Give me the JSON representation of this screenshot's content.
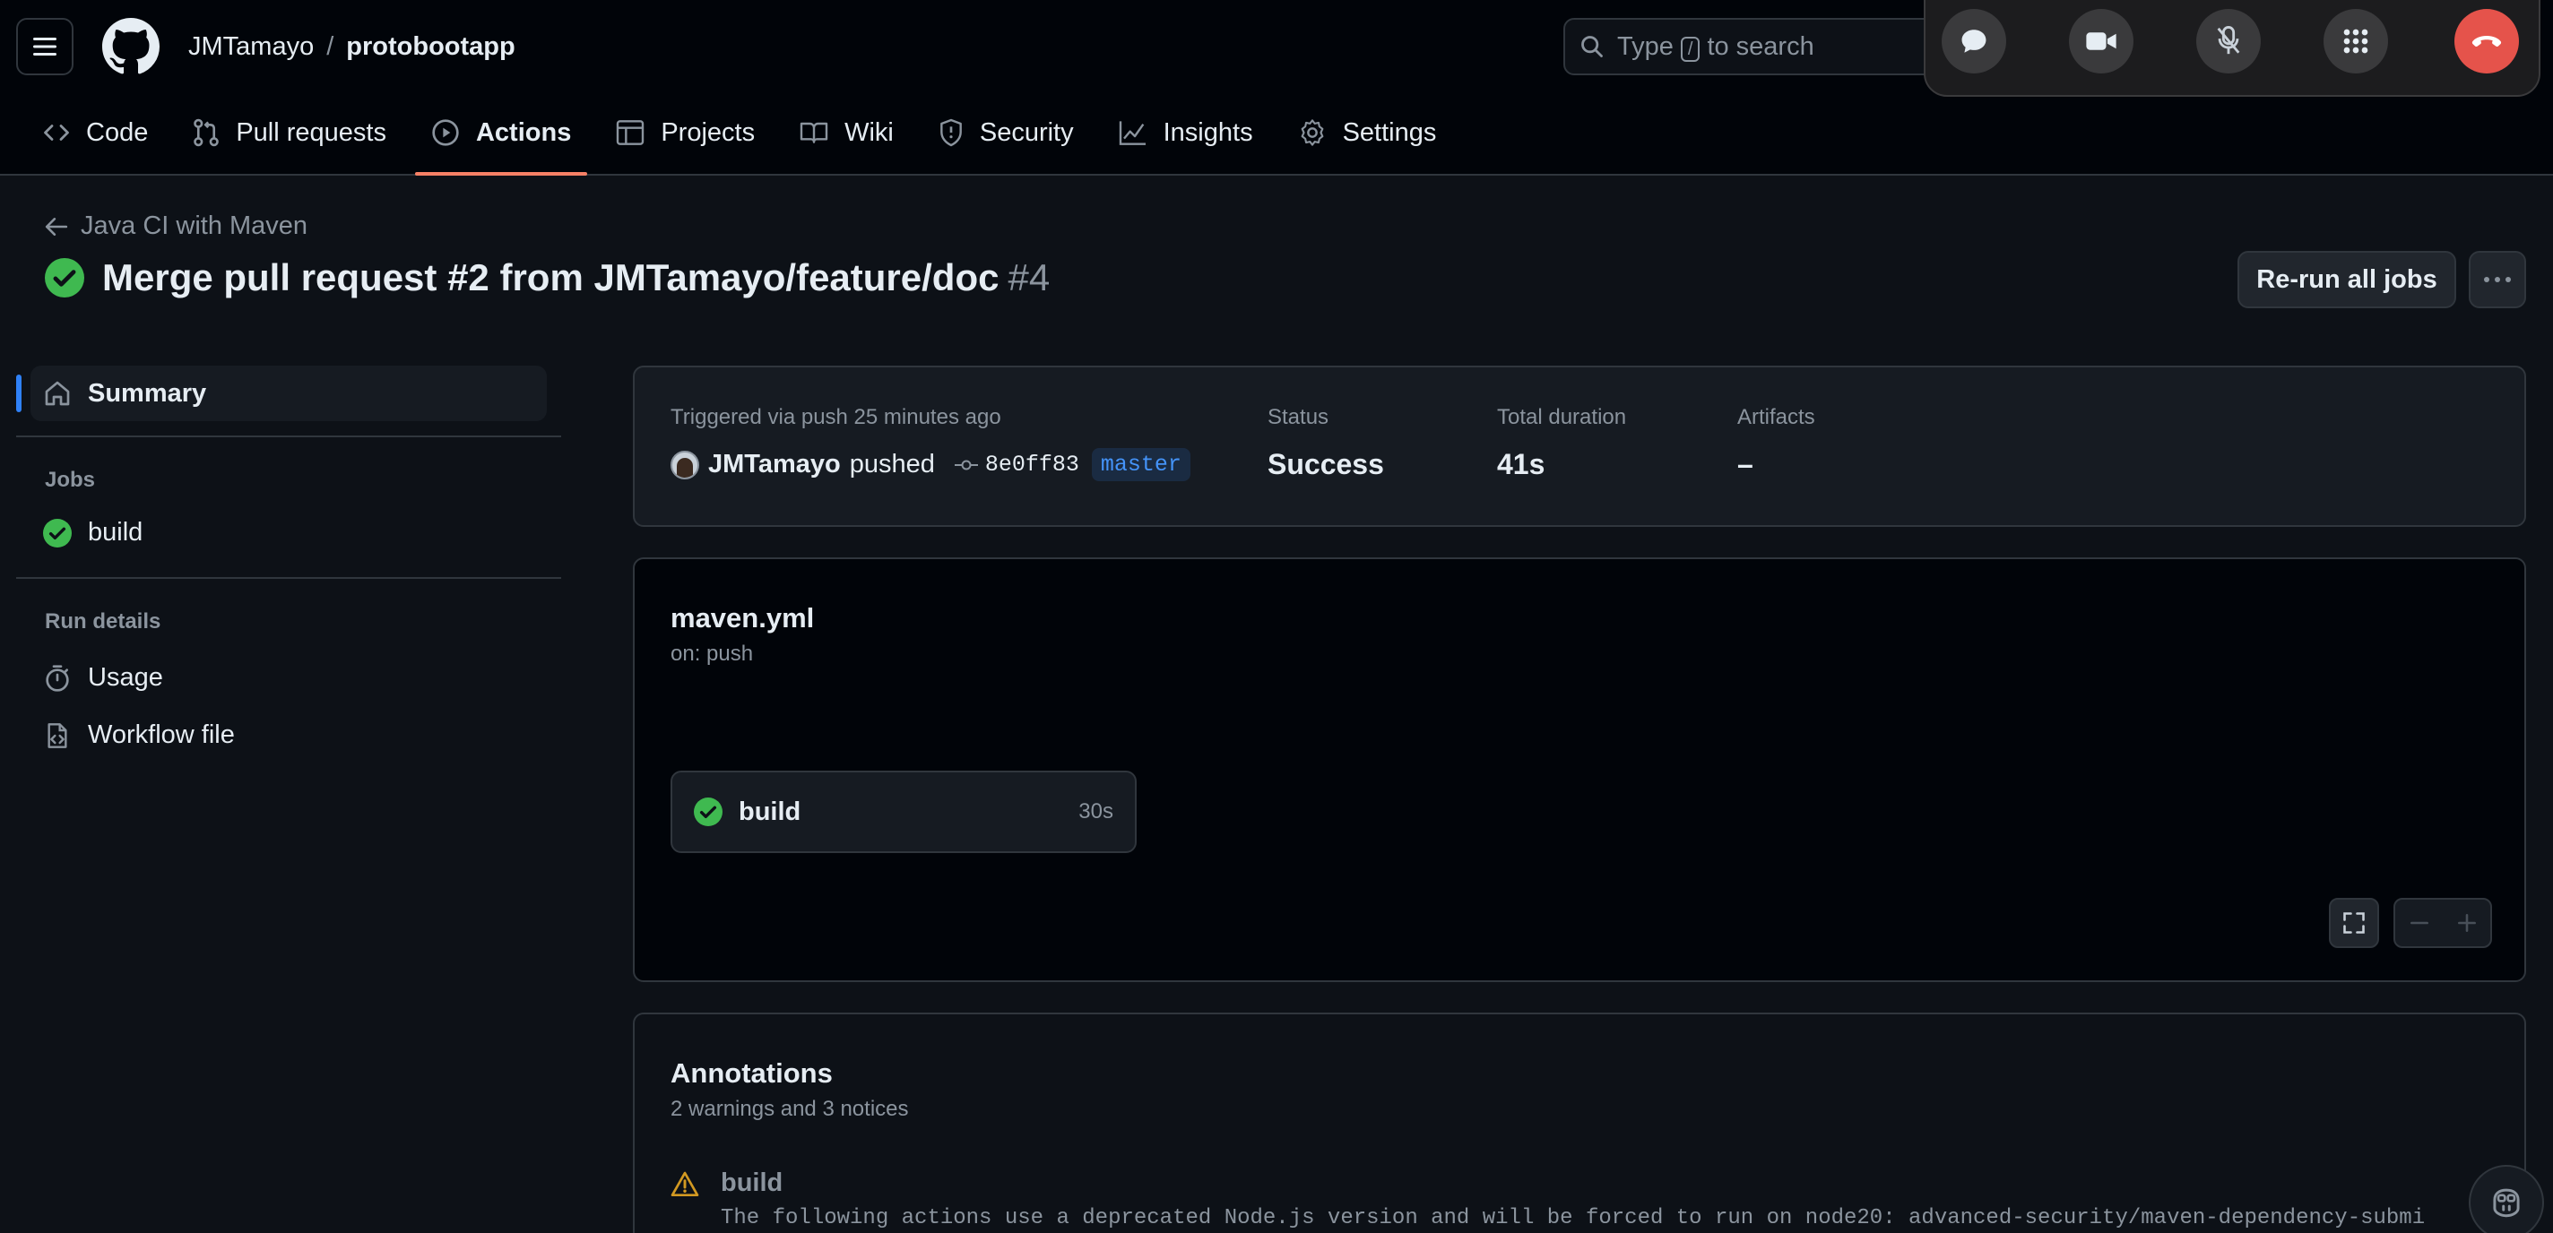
{
  "header": {
    "owner": "JMTamayo",
    "separator": "/",
    "repo": "protobootapp",
    "search": {
      "prefix": "Type",
      "key": "/",
      "suffix": "to search"
    }
  },
  "call_controls": {
    "icons": [
      "chat-bubble-icon",
      "video-camera-icon",
      "microphone-muted-icon",
      "keypad-icon",
      "end-call-icon"
    ],
    "end_color": "#e5534b"
  },
  "reponav": {
    "tabs": [
      {
        "label": "Code",
        "icon": "code-icon"
      },
      {
        "label": "Pull requests",
        "icon": "pull-request-icon"
      },
      {
        "label": "Actions",
        "icon": "play-icon",
        "active": true
      },
      {
        "label": "Projects",
        "icon": "table-icon"
      },
      {
        "label": "Wiki",
        "icon": "book-icon"
      },
      {
        "label": "Security",
        "icon": "shield-icon"
      },
      {
        "label": "Insights",
        "icon": "graph-icon"
      },
      {
        "label": "Settings",
        "icon": "gear-icon"
      }
    ],
    "active_color": "#f78166"
  },
  "run": {
    "workflow_link": "Java CI with Maven",
    "title": "Merge pull request #2 from JMTamayo/feature/doc",
    "number": "#4",
    "rerun_label": "Re-run all jobs"
  },
  "sidebar": {
    "summary": "Summary",
    "jobs_heading": "Jobs",
    "jobs": [
      {
        "label": "build"
      }
    ],
    "run_details_heading": "Run details",
    "details": [
      {
        "label": "Usage"
      },
      {
        "label": "Workflow file"
      }
    ]
  },
  "summary": {
    "triggered": "Triggered via push 25 minutes ago",
    "actor": "JMTamayo",
    "action": "pushed",
    "sha": "8e0ff83",
    "branch": "master",
    "status_label": "Status",
    "status_value": "Success",
    "duration_label": "Total duration",
    "duration_value": "41s",
    "artifacts_label": "Artifacts",
    "artifacts_value": "–"
  },
  "workflow": {
    "file": "maven.yml",
    "trigger": "on: push",
    "job": {
      "name": "build",
      "duration": "30s"
    }
  },
  "annotations": {
    "title": "Annotations",
    "subtitle": "2 warnings and 3 notices",
    "items": [
      {
        "job": "build",
        "message": "The following actions use a deprecated Node.js version and will be forced to run on node20: advanced-security/maven-dependency-submi"
      }
    ],
    "warning_color": "#d29922"
  },
  "colors": {
    "success": "#3fb950",
    "accent": "#2f81f7",
    "link": "#4493f8"
  }
}
